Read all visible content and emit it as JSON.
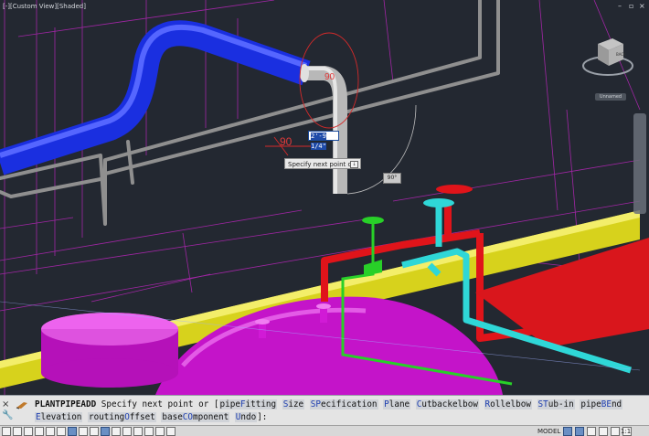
{
  "viewport": {
    "label": "[-][Custom View][Shaded]",
    "window_controls": [
      "–",
      "▫",
      "×"
    ],
    "viewcube_face": "BACK",
    "ucs_label": "Unnamed",
    "dynamic_input_value": "2'-9 1/4\"",
    "tooltip_text": "Specify next point or",
    "angle_value": "90°",
    "dim_label_large": "90",
    "dim_label_small": "90",
    "colors": {
      "background": "#232831",
      "blue_pipe": "#1a2fe0",
      "yellow_pipe": "#d7d21c",
      "red_pipe": "#e0141a",
      "cyan_pipe": "#2fd7d7",
      "green_pipe": "#28d028",
      "magenta_vessel": "#d11ad6",
      "gray_rail": "#8a8a8a"
    }
  },
  "command_line": {
    "left_icons": [
      "close-icon",
      "wrench-icon"
    ],
    "command": "PLANTPIPEADD",
    "prompt": "Specify next point or [",
    "options_line1": [
      {
        "text": "pipeFitting",
        "key": "F"
      },
      {
        "text": "Size",
        "key": "S"
      },
      {
        "text": "SPecification",
        "key": "SP"
      },
      {
        "text": "Plane",
        "key": "P"
      },
      {
        "text": "Cutbackelbow",
        "key": "C"
      },
      {
        "text": "Rollelbow",
        "key": "R"
      },
      {
        "text": "STub-in",
        "key": "ST"
      },
      {
        "text": "pipeBEnd",
        "key": "BE"
      }
    ],
    "options_line2": [
      {
        "text": "Elevation",
        "key": "E"
      },
      {
        "text": "routingOffset",
        "key": "O"
      },
      {
        "text": "baseCOmponent",
        "key": "CO"
      },
      {
        "text": "Undo",
        "key": "U"
      }
    ],
    "suffix": "]:"
  },
  "status_bar": {
    "model_label": "MODEL",
    "scale_label": "1:1"
  }
}
